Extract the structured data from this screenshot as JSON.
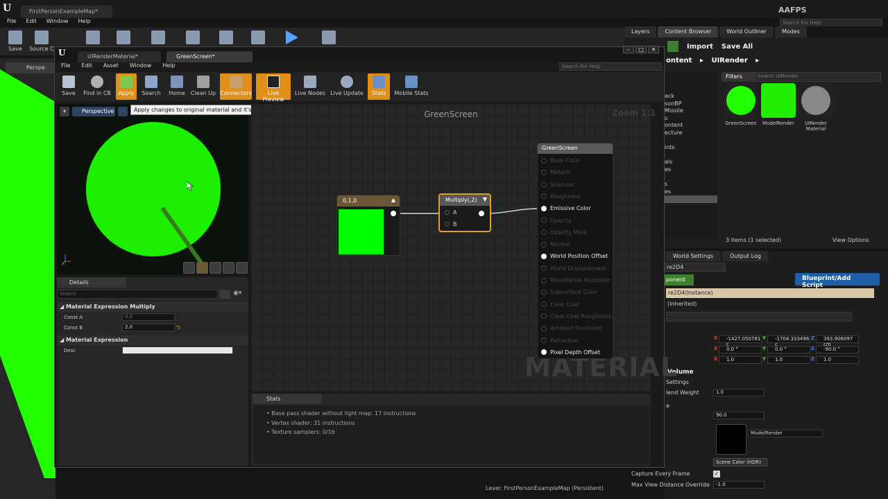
{
  "main": {
    "tab_title": "FirstPersonExampleMap*",
    "project_name": "AAFPS",
    "help_placeholder": "Search For Help",
    "menu": [
      "File",
      "Edit",
      "Window",
      "Help"
    ],
    "toolbar": {
      "save": "Save",
      "source": "Source C"
    },
    "viewport_label": "Perspe",
    "level": "Level:  FirstPersonExampleMap (Persistent)"
  },
  "right_panel": {
    "tabs": [
      "Layers",
      "Content Browser",
      "World Outliner",
      "Modes"
    ],
    "import_label": "Import",
    "save_all_label": "Save All",
    "path_root": "ontent",
    "path_folder": "UIRender",
    "filters_label": "Filters",
    "search_placeholder": "Search UIRender",
    "folders": [
      "ack",
      "sonBP",
      "Missile",
      "s",
      "ontent",
      "ecture",
      "",
      "ints",
      "",
      "als",
      "es",
      "",
      "s",
      "es",
      ""
    ],
    "assets": [
      {
        "name": "GreenScreen",
        "color": "#22ff00"
      },
      {
        "name": "ModelRender",
        "color": "#22ee00"
      },
      {
        "name": "UIRender Material",
        "color": "#888888"
      }
    ],
    "items_count": "3 items (1 selected)",
    "view_options": "View Options"
  },
  "details_right": {
    "tabs": [
      "World Settings",
      "Output Log"
    ],
    "name_value": "re2D4",
    "component_btn": "ponent",
    "blueprint_btn": "Blueprint/Add Script",
    "instance_label": "re2D4(Instance)",
    "inherited_label": "(Inherited)",
    "location": [
      "-1427.050781 c",
      "-1704.333496 c",
      "393.906097 cm"
    ],
    "rotation": [
      "0.0 °",
      "0.0 °",
      "-90.0 °"
    ],
    "scale": [
      "1.0",
      "1.0",
      "1.0"
    ],
    "volume_header": "Volume",
    "settings_label": "Settings",
    "blend_weight_label": "lend Weight",
    "blend_weight_value": "1.0",
    "e_label": "e",
    "fov_value": "90.0",
    "texture_target": "ModelRender",
    "capture_source": "Scene Color (HDR)",
    "capture_every_frame_label": "Capture Every Frame",
    "max_view_distance_label": "Max View Distance Override",
    "max_view_distance_value": "-1.0"
  },
  "material_editor": {
    "tabs": [
      {
        "label": "UIRenderMaterial*"
      },
      {
        "label": "GreenScreen*"
      }
    ],
    "menu": [
      "File",
      "Edit",
      "Asset",
      "Window",
      "Help"
    ],
    "help_placeholder": "Search For Help",
    "toolbar": [
      "Save",
      "Find in CB",
      "Apply",
      "Search",
      "Home",
      "Clean Up",
      "Connectors",
      "Live Preview",
      "Live Nodes",
      "Live Update",
      "Stats",
      "Mobile Stats"
    ],
    "viewport_mode": "Perspective",
    "tooltip": "Apply changes to original material and it's use in the world. (Enter)",
    "details_tab": "Details",
    "details_search_placeholder": "Search",
    "section_multiply": "Material Expression Multiply",
    "const_a_label": "Const A",
    "const_a_value": "0.0",
    "const_b_label": "Const B",
    "const_b_value": "2.0",
    "section_expression": "Material Expression",
    "desc_label": "Desc",
    "graph_title": "GreenScreen",
    "zoom_label": "Zoom 1:1",
    "watermark": "MATERIAL",
    "const_node_title": "0,1,0",
    "multiply_node_title": "Multiply(,2)",
    "multiply_pins": [
      "A",
      "B"
    ],
    "result_node_title": "GreenScreen",
    "result_pins": [
      {
        "label": "Base Color",
        "active": false
      },
      {
        "label": "Metallic",
        "active": false
      },
      {
        "label": "Specular",
        "active": false
      },
      {
        "label": "Roughness",
        "active": false
      },
      {
        "label": "Emissive Color",
        "active": true
      },
      {
        "label": "Opacity",
        "active": false
      },
      {
        "label": "Opacity Mask",
        "active": false
      },
      {
        "label": "Normal",
        "active": false
      },
      {
        "label": "World Position Offset",
        "active": true
      },
      {
        "label": "World Displacement",
        "active": false
      },
      {
        "label": "Tessellation Multiplier",
        "active": false
      },
      {
        "label": "Subsurface Color",
        "active": false
      },
      {
        "label": "Clear Coat",
        "active": false
      },
      {
        "label": "Clear Coat Roughness",
        "active": false
      },
      {
        "label": "Ambient Occlusion",
        "active": false
      },
      {
        "label": "Refraction",
        "active": false
      },
      {
        "label": "Pixel Depth Offset",
        "active": true
      }
    ],
    "stats_tab": "Stats",
    "stats_lines": [
      "Base pass shader without light map: 17 instructions",
      "Vertex shader: 31 instructions",
      "Texture samplers: 0/16"
    ]
  },
  "colors": {
    "accent_orange": "#e08f18",
    "green": "#22ff00",
    "blue_button": "#1e5fa8"
  }
}
